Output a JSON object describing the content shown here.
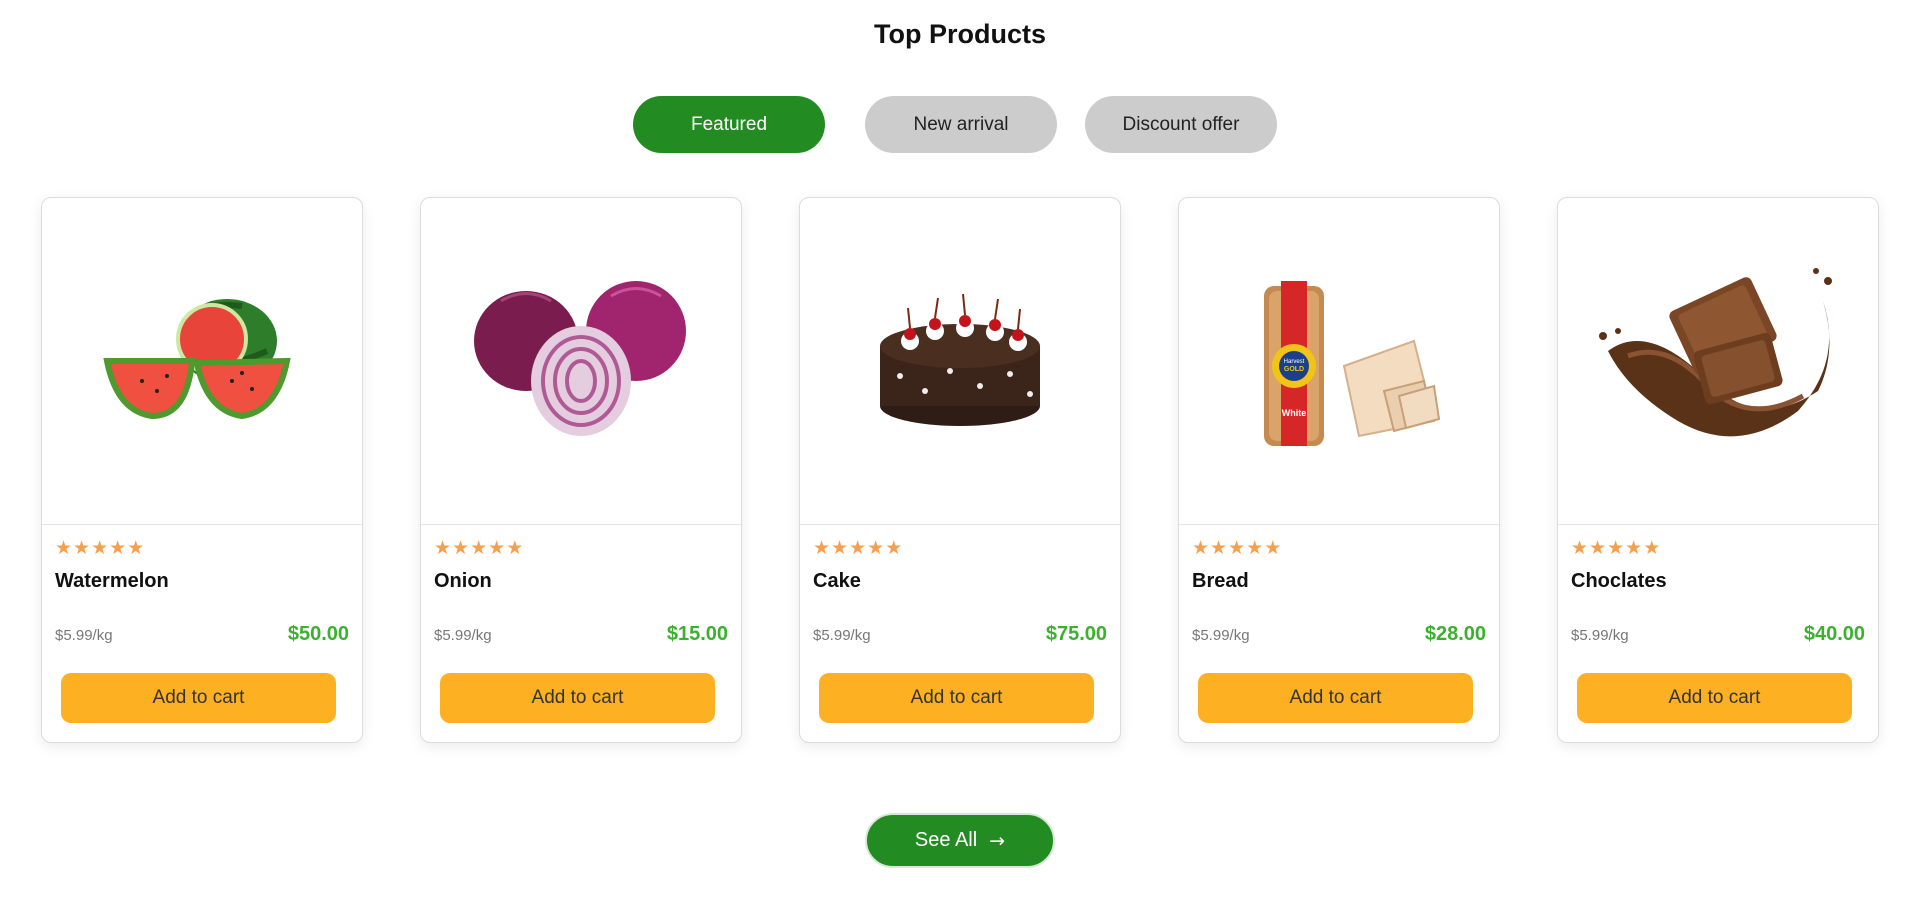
{
  "section": {
    "title": "Top Products"
  },
  "tabs": [
    {
      "label": "Featured",
      "active": true
    },
    {
      "label": "New arrival",
      "active": false
    },
    {
      "label": "Discount offer",
      "active": false
    }
  ],
  "products": [
    {
      "name": "Watermelon",
      "rating": 5,
      "unit_price": "$5.99/kg",
      "price": "$50.00",
      "button": "Add to cart",
      "image_icon": "watermelon-image"
    },
    {
      "name": "Onion",
      "rating": 5,
      "unit_price": "$5.99/kg",
      "price": "$15.00",
      "button": "Add to cart",
      "image_icon": "onion-image"
    },
    {
      "name": "Cake",
      "rating": 5,
      "unit_price": "$5.99/kg",
      "price": "$75.00",
      "button": "Add to cart",
      "image_icon": "cake-image"
    },
    {
      "name": "Bread",
      "rating": 5,
      "unit_price": "$5.99/kg",
      "price": "$28.00",
      "button": "Add to cart",
      "image_icon": "bread-image",
      "image_text": [
        "Harvest",
        "GOLD",
        "White"
      ]
    },
    {
      "name": "Choclates",
      "rating": 5,
      "unit_price": "$5.99/kg",
      "price": "$40.00",
      "button": "Add to cart",
      "image_icon": "chocolate-image"
    }
  ],
  "see_all": {
    "label": "See All",
    "icon": "arrow-right-icon"
  },
  "colors": {
    "primary_green": "#228b22",
    "inactive_tab": "#cccccc",
    "star": "#f6a04d",
    "price_green": "#3cb02f",
    "cart_button": "#fdb022"
  }
}
